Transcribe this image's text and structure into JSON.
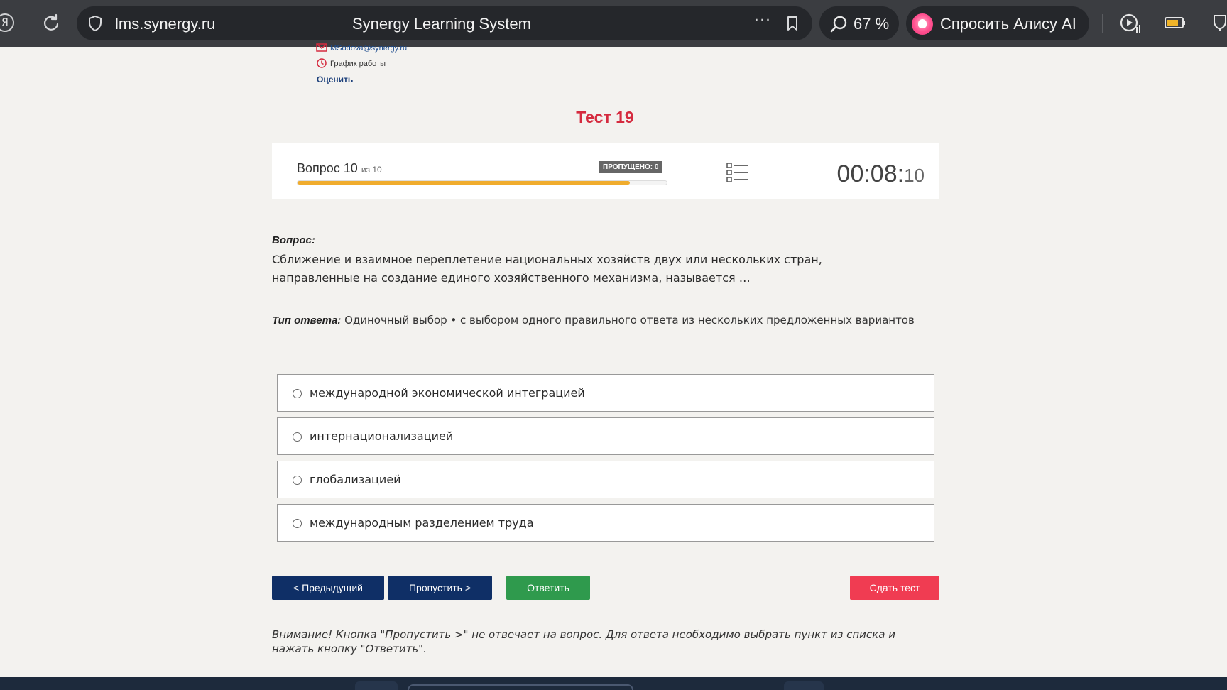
{
  "browser": {
    "domain": "lms.synergy.ru",
    "page_title": "Synergy Learning System",
    "more_label": "···",
    "zoom": "67 %",
    "alice_label": "Спросить Алису AI"
  },
  "contact": {
    "email": "MSodova@synergy.ru",
    "schedule": "График работы",
    "rate": "Оценить"
  },
  "test": {
    "title": "Тест 19",
    "question_label": "Вопрос 10",
    "question_of": "из 10",
    "skipped_badge": "ПРОПУЩЕНО: 0",
    "progress_percent": 90,
    "timer_main": "00:08:",
    "timer_seconds": "10"
  },
  "question": {
    "label": "Вопрос:",
    "text": "Сближение и взаимное переплетение национальных хозяйств двух или нескольких стран, направленные на создание единого хозяйственного механизма, называется …",
    "type_label": "Тип ответа:",
    "type_value": "Одиночный выбор • с выбором одного правильного ответа из нескольких предложенных вариантов"
  },
  "options": [
    "международной экономической интеграцией",
    "интернационализацией",
    "глобализацией",
    "международным разделением труда"
  ],
  "buttons": {
    "prev": "< Предыдущий",
    "skip": "Пропустить >",
    "answer": "Ответить",
    "submit": "Сдать тест"
  },
  "warning": "Внимание! Кнопка \"Пропустить >\" не отвечает на вопрос. Для ответа необходимо выбрать пункт из списка и нажать кнопку \"Ответить\".",
  "colors": {
    "title_red": "#d52b3f",
    "navy": "#0f2f66",
    "green": "#2f9a4d",
    "submit_red": "#f03c52",
    "progress": "#f0ac2d"
  }
}
